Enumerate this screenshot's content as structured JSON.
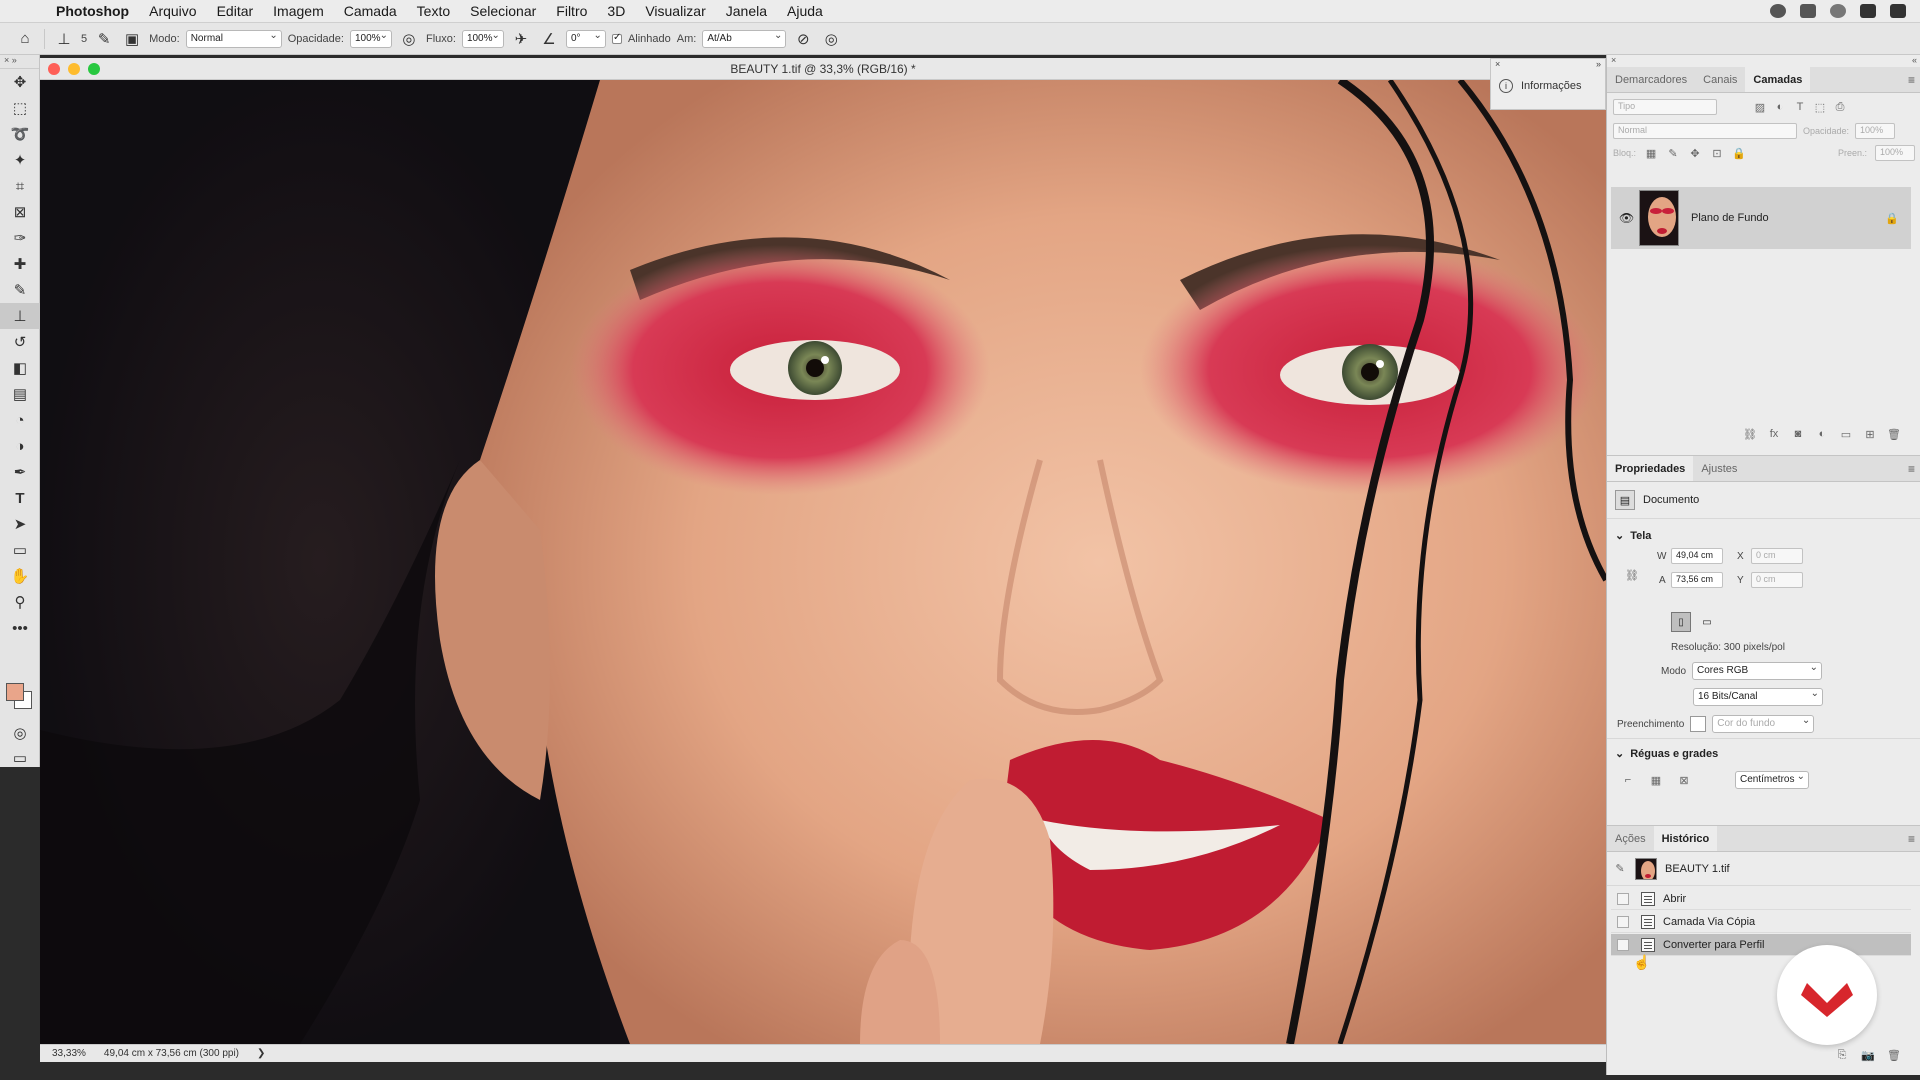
{
  "menubar": {
    "items": [
      "Photoshop",
      "Arquivo",
      "Editar",
      "Imagem",
      "Camada",
      "Texto",
      "Selecionar",
      "Filtro",
      "3D",
      "Visualizar",
      "Janela",
      "Ajuda"
    ]
  },
  "options": {
    "brush_size": "5",
    "mode_label": "Modo:",
    "mode_value": "Normal",
    "opacity_label": "Opacidade:",
    "opacity_value": "100%",
    "flow_label": "Fluxo:",
    "flow_value": "100%",
    "angle_value": "0°",
    "aligned_label": "Alinhado",
    "sample_label": "Am:",
    "sample_value": "At/Ab"
  },
  "document": {
    "title": "BEAUTY 1.tif @ 33,3% (RGB/16) *",
    "zoom": "33,33%",
    "size_info": "49,04 cm x 73,56 cm (300 ppi)",
    "status_arrow": "❯"
  },
  "info_panel": {
    "label": "Informações"
  },
  "layers_panel": {
    "tabs": [
      "Demarcadores",
      "Canais",
      "Camadas"
    ],
    "active_tab": "Camadas",
    "search_placeholder": "Tipo",
    "blend_mode": "Normal",
    "opacity_label": "Opacidade:",
    "opacity_value": "100%",
    "lock_label": "Bloq.:",
    "fill_label": "Preen.:",
    "fill_value": "100%",
    "layer_name": "Plano de Fundo"
  },
  "properties_panel": {
    "tabs": [
      "Propriedades",
      "Ajustes"
    ],
    "active_tab": "Propriedades",
    "doc_label": "Documento",
    "canvas_section": "Tela",
    "w_label": "W",
    "w_value": "49,04 cm",
    "x_label": "X",
    "x_placeholder": "0 cm",
    "a_label": "A",
    "a_value": "73,56 cm",
    "y_label": "Y",
    "y_placeholder": "0 cm",
    "resolution": "Resolução: 300 pixels/pol",
    "mode_label": "Modo",
    "mode_value": "Cores RGB",
    "bits_value": "16 Bits/Canal",
    "fill_label": "Preenchimento",
    "fill_value": "Cor do fundo",
    "rulers_section": "Réguas e grades",
    "units_value": "Centímetros"
  },
  "history_panel": {
    "tabs": [
      "Ações",
      "Histórico"
    ],
    "active_tab": "Histórico",
    "snapshot": "BEAUTY 1.tif",
    "items": [
      "Abrir",
      "Camada Via Cópia",
      "Converter para Perfil"
    ],
    "selected_index": 2
  },
  "colors": {
    "foreground": "#e9a58a",
    "background": "#ffffff",
    "logo": "#d7262c"
  }
}
